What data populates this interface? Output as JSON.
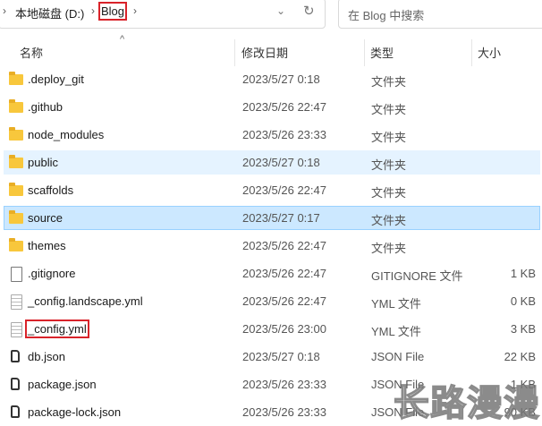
{
  "breadcrumb": [
    "本地磁盘 (D:)",
    "Blog"
  ],
  "search": {
    "placeholder": "在 Blog 中搜索"
  },
  "columns": {
    "name": "名称",
    "date": "修改日期",
    "type": "类型",
    "size": "大小"
  },
  "files": [
    {
      "name": ".deploy_git",
      "date": "2023/5/27 0:18",
      "type": "文件夹",
      "size": "",
      "icon": "folder"
    },
    {
      "name": ".github",
      "date": "2023/5/26 22:47",
      "type": "文件夹",
      "size": "",
      "icon": "folder"
    },
    {
      "name": "node_modules",
      "date": "2023/5/26 23:33",
      "type": "文件夹",
      "size": "",
      "icon": "folder"
    },
    {
      "name": "public",
      "date": "2023/5/27 0:18",
      "type": "文件夹",
      "size": "",
      "icon": "folder"
    },
    {
      "name": "scaffolds",
      "date": "2023/5/26 22:47",
      "type": "文件夹",
      "size": "",
      "icon": "folder"
    },
    {
      "name": "source",
      "date": "2023/5/27 0:17",
      "type": "文件夹",
      "size": "",
      "icon": "folder"
    },
    {
      "name": "themes",
      "date": "2023/5/26 22:47",
      "type": "文件夹",
      "size": "",
      "icon": "folder"
    },
    {
      "name": ".gitignore",
      "date": "2023/5/26 22:47",
      "type": "GITIGNORE 文件",
      "size": "1 KB",
      "icon": "file"
    },
    {
      "name": "_config.landscape.yml",
      "date": "2023/5/26 22:47",
      "type": "YML 文件",
      "size": "0 KB",
      "icon": "text-file"
    },
    {
      "name": "_config.yml",
      "date": "2023/5/26 23:00",
      "type": "YML 文件",
      "size": "3 KB",
      "icon": "text-file"
    },
    {
      "name": "db.json",
      "date": "2023/5/27 0:18",
      "type": "JSON File",
      "size": "22 KB",
      "icon": "json-file"
    },
    {
      "name": "package.json",
      "date": "2023/5/26 23:33",
      "type": "JSON File",
      "size": "1 KB",
      "icon": "json-file"
    },
    {
      "name": "package-lock.json",
      "date": "2023/5/26 23:33",
      "type": "JSON File",
      "size": "90 KB",
      "icon": "json-file"
    }
  ],
  "watermark": "长路漫漫"
}
